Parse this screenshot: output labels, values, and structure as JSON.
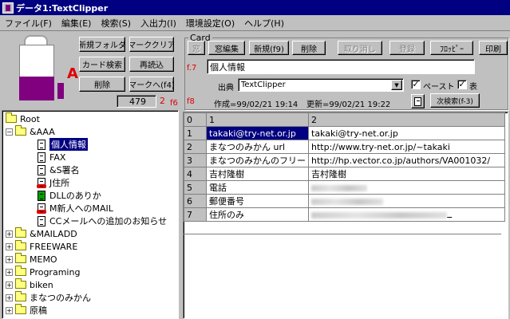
{
  "window": {
    "title": "データ1:TextClipper"
  },
  "menu": [
    "ファイル(F)",
    "編集(E)",
    "検索(S)",
    "入出力(I)",
    "環境設定(O)",
    "ヘルプ(H)"
  ],
  "left_panel": {
    "buttons": {
      "new_folder": "新規フォルダ",
      "mark_clear": "マーククリア",
      "card_search": "カード検索",
      "reload": "再読込",
      "delete": "削除",
      "mark_to": "マークへ(f4)"
    },
    "count": "479",
    "count_marker": "2",
    "icon_marker": "A"
  },
  "card": {
    "group_label": "Card",
    "f6_label": "f6",
    "f7_label": "f.7",
    "f8_label": "f8",
    "toolbar": {
      "window": "窓",
      "window_edit": "窓編集",
      "new": "新規(f9)",
      "delete": "削除",
      "undo": "取り消し",
      "register": "登録",
      "floppy": "ﾌﾛｯﾋﾟｰ",
      "print": "印刷"
    },
    "title_value": "個人情報",
    "source_label": "出典",
    "source_value": "TextClipper",
    "paste_label": "ペースト",
    "paste_checked": true,
    "table_label": "表",
    "table_checked": true,
    "created": "作成=99/02/21 19:14",
    "updated": "更新=99/02/21 19:22",
    "next_search": "次検索(f-3)"
  },
  "tree": {
    "root": "Root",
    "items": [
      {
        "label": "&AAA",
        "type": "folder",
        "expander": "−"
      },
      {
        "label": "個人情報",
        "type": "doc",
        "selected": true
      },
      {
        "label": "FAX",
        "type": "doc"
      },
      {
        "label": "&S署名",
        "type": "doc"
      },
      {
        "label": "J住所",
        "type": "doc-red"
      },
      {
        "label": "DLLのありか",
        "type": "doc-green"
      },
      {
        "label": "M新人へのMAIL",
        "type": "doc-red"
      },
      {
        "label": "CCメールへの追加のお知らせ",
        "type": "doc"
      },
      {
        "label": "&MAILADD",
        "type": "folder",
        "expander": "+"
      },
      {
        "label": "FREEWARE",
        "type": "folder",
        "expander": "+"
      },
      {
        "label": "MEMO",
        "type": "folder",
        "expander": "+"
      },
      {
        "label": "Programing",
        "type": "folder",
        "expander": "+"
      },
      {
        "label": "biken",
        "type": "folder",
        "expander": "+"
      },
      {
        "label": "まなつのみかん",
        "type": "folder",
        "expander": "+"
      },
      {
        "label": "原稿",
        "type": "folder",
        "expander": "+"
      }
    ]
  },
  "grid": {
    "headers": [
      "0",
      "1",
      "2"
    ],
    "rows": [
      {
        "n": "1",
        "c1": "takaki@try-net.or.jp",
        "c2": "takaki@try-net.or.jp"
      },
      {
        "n": "2",
        "c1": "まなつのみかん url",
        "c2": "http://www.try-net.or.jp/~takaki"
      },
      {
        "n": "3",
        "c1": "まなつのみかんのフリー",
        "c2": "http://hp.vector.co.jp/authors/VA001032/"
      },
      {
        "n": "4",
        "c1": "吉村隆樹",
        "c2": "吉村隆樹"
      },
      {
        "n": "5",
        "c1": "電話",
        "c2": ""
      },
      {
        "n": "6",
        "c1": "郵便番号",
        "c2": ""
      },
      {
        "n": "7",
        "c1": "住所のみ",
        "c2": ""
      }
    ]
  }
}
